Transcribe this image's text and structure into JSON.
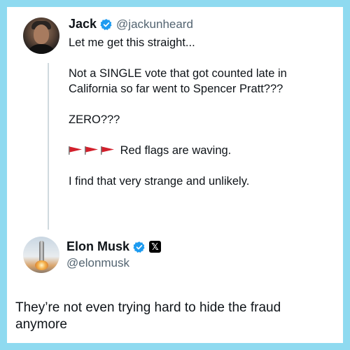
{
  "tweet": {
    "author_name": "Jack",
    "author_handle": "@jackunheard",
    "lines": [
      "Let me get this straight...",
      "Not a SINGLE vote that got counted late in",
      "California so far went to Spencer Pratt???",
      "ZERO???",
      "Red flags are waving.",
      "I find that very strange and unlikely."
    ]
  },
  "reply": {
    "author_name": "Elon Musk",
    "author_handle": "@elonmusk",
    "x_badge": "𝕏",
    "text_line1": "They’re not even trying hard to hide the fraud",
    "text_line2": "anymore"
  },
  "colors": {
    "frame": "#8fdaf0",
    "verified": "#1d9bf0",
    "flag": "#d2202c",
    "thread_line": "#cfd9de"
  },
  "icons": {
    "verified": "verified-badge-icon",
    "flag": "red-flag-icon",
    "x_logo": "x-logo-icon"
  }
}
